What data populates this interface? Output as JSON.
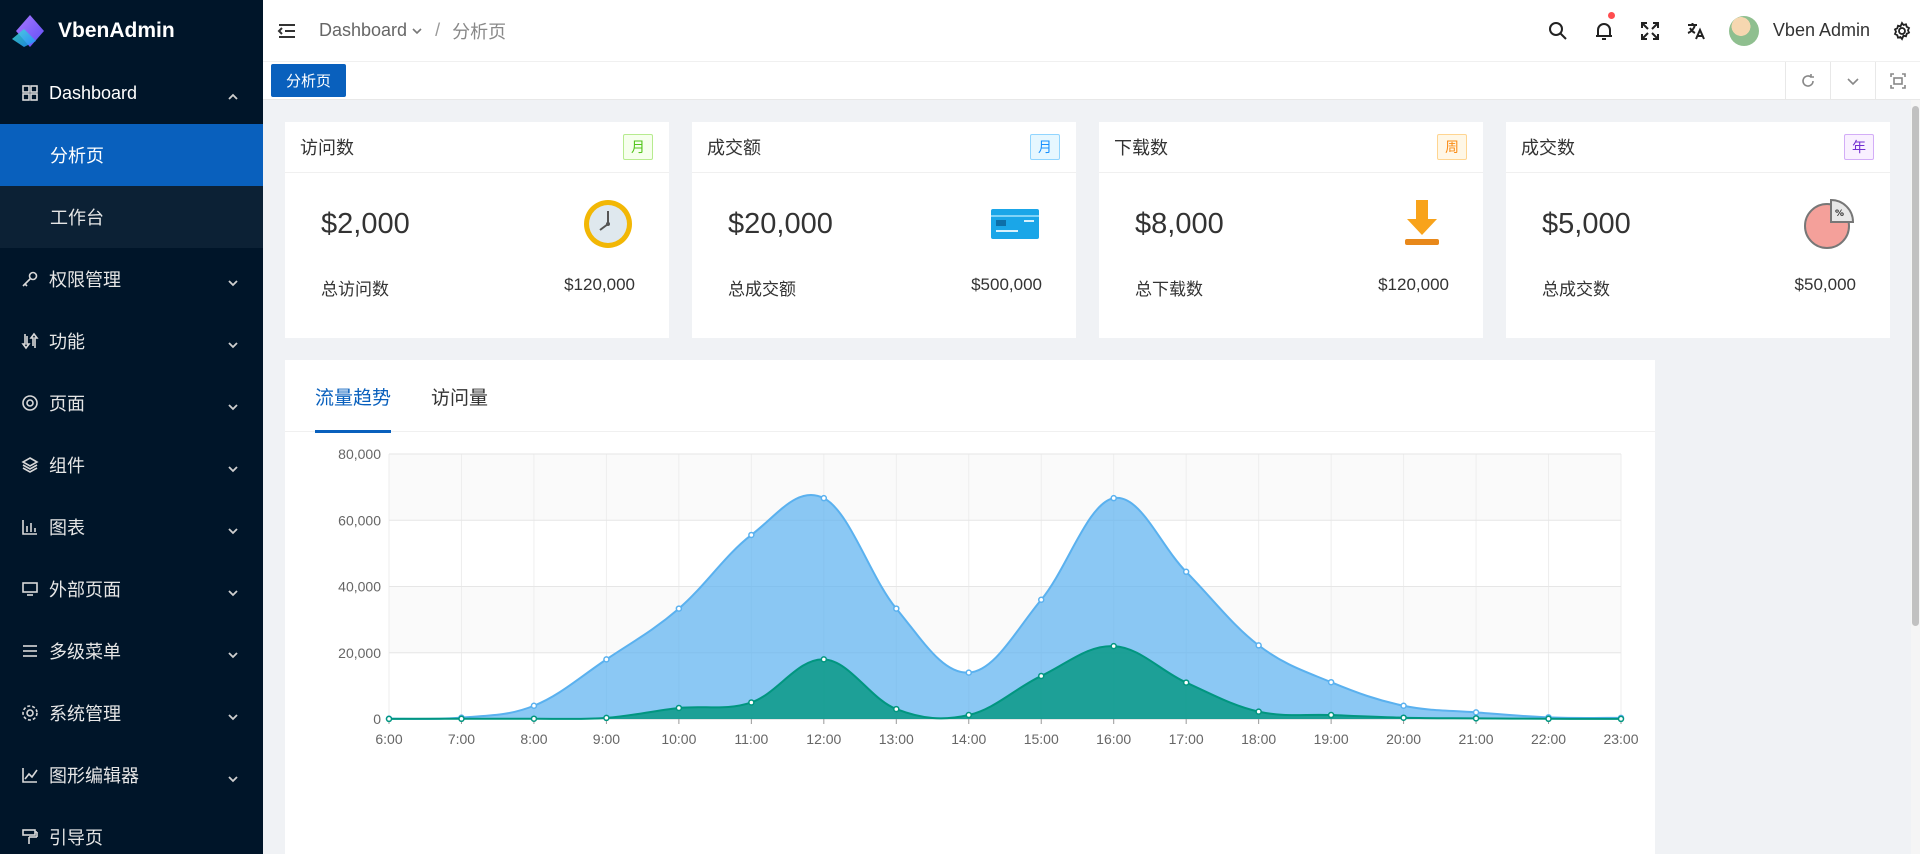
{
  "app": {
    "name": "VbenAdmin"
  },
  "sidebar": {
    "items": [
      {
        "label": "Dashboard",
        "icon": "dashboard-icon",
        "open": true,
        "children": [
          {
            "label": "分析页",
            "active": true
          },
          {
            "label": "工作台",
            "active": false
          }
        ]
      },
      {
        "label": "权限管理",
        "icon": "key-icon"
      },
      {
        "label": "功能",
        "icon": "function-icon"
      },
      {
        "label": "页面",
        "icon": "page-icon"
      },
      {
        "label": "组件",
        "icon": "layers-icon"
      },
      {
        "label": "图表",
        "icon": "bar-chart-icon"
      },
      {
        "label": "外部页面",
        "icon": "desktop-icon"
      },
      {
        "label": "多级菜单",
        "icon": "menu-icon"
      },
      {
        "label": "系统管理",
        "icon": "settings-icon"
      },
      {
        "label": "图形编辑器",
        "icon": "graph-editor-icon"
      },
      {
        "label": "引导页",
        "icon": "guide-icon"
      }
    ]
  },
  "header": {
    "breadcrumb": {
      "root": "Dashboard",
      "separator": "/",
      "current": "分析页"
    },
    "user_name": "Vben Admin"
  },
  "tabs": {
    "active_label": "分析页"
  },
  "cards": [
    {
      "title": "访问数",
      "tag": "月",
      "value": "$2,000",
      "footer_label": "总访问数",
      "footer_value": "$120,000",
      "icon": "clock-icon"
    },
    {
      "title": "成交额",
      "tag": "月",
      "value": "$20,000",
      "footer_label": "总成交额",
      "footer_value": "$500,000",
      "icon": "credit-card-icon"
    },
    {
      "title": "下载数",
      "tag": "周",
      "value": "$8,000",
      "footer_label": "总下载数",
      "footer_value": "$120,000",
      "icon": "download-icon"
    },
    {
      "title": "成交数",
      "tag": "年",
      "value": "$5,000",
      "footer_label": "总成交数",
      "footer_value": "$50,000",
      "icon": "pie-chart-icon"
    }
  ],
  "chart_tabs": [
    "流量趋势",
    "访问量"
  ],
  "colors": {
    "primary": "#0960bd",
    "series1": "#5ab1ef",
    "series2": "#019680",
    "sidebar_bg": "#001529"
  },
  "chart_data": {
    "type": "area",
    "x": [
      "6:00",
      "7:00",
      "8:00",
      "9:00",
      "10:00",
      "11:00",
      "12:00",
      "13:00",
      "14:00",
      "15:00",
      "16:00",
      "17:00",
      "18:00",
      "19:00",
      "20:00",
      "21:00",
      "22:00",
      "23:00"
    ],
    "series": [
      {
        "values": [
          111,
          400,
          4000,
          18000,
          33333,
          55555,
          66666,
          33333,
          14000,
          36000,
          66666,
          44444,
          22222,
          11111,
          4000,
          2000,
          500,
          333
        ]
      },
      {
        "values": [
          33,
          66,
          88,
          333,
          3333,
          5000,
          18000,
          3000,
          1200,
          13000,
          22000,
          11000,
          2221,
          1201,
          390,
          198,
          60,
          30
        ]
      }
    ],
    "ylim": [
      0,
      80000
    ],
    "yticks": [
      "0",
      "20,000",
      "40,000",
      "60,000",
      "80,000"
    ],
    "grid": true
  }
}
